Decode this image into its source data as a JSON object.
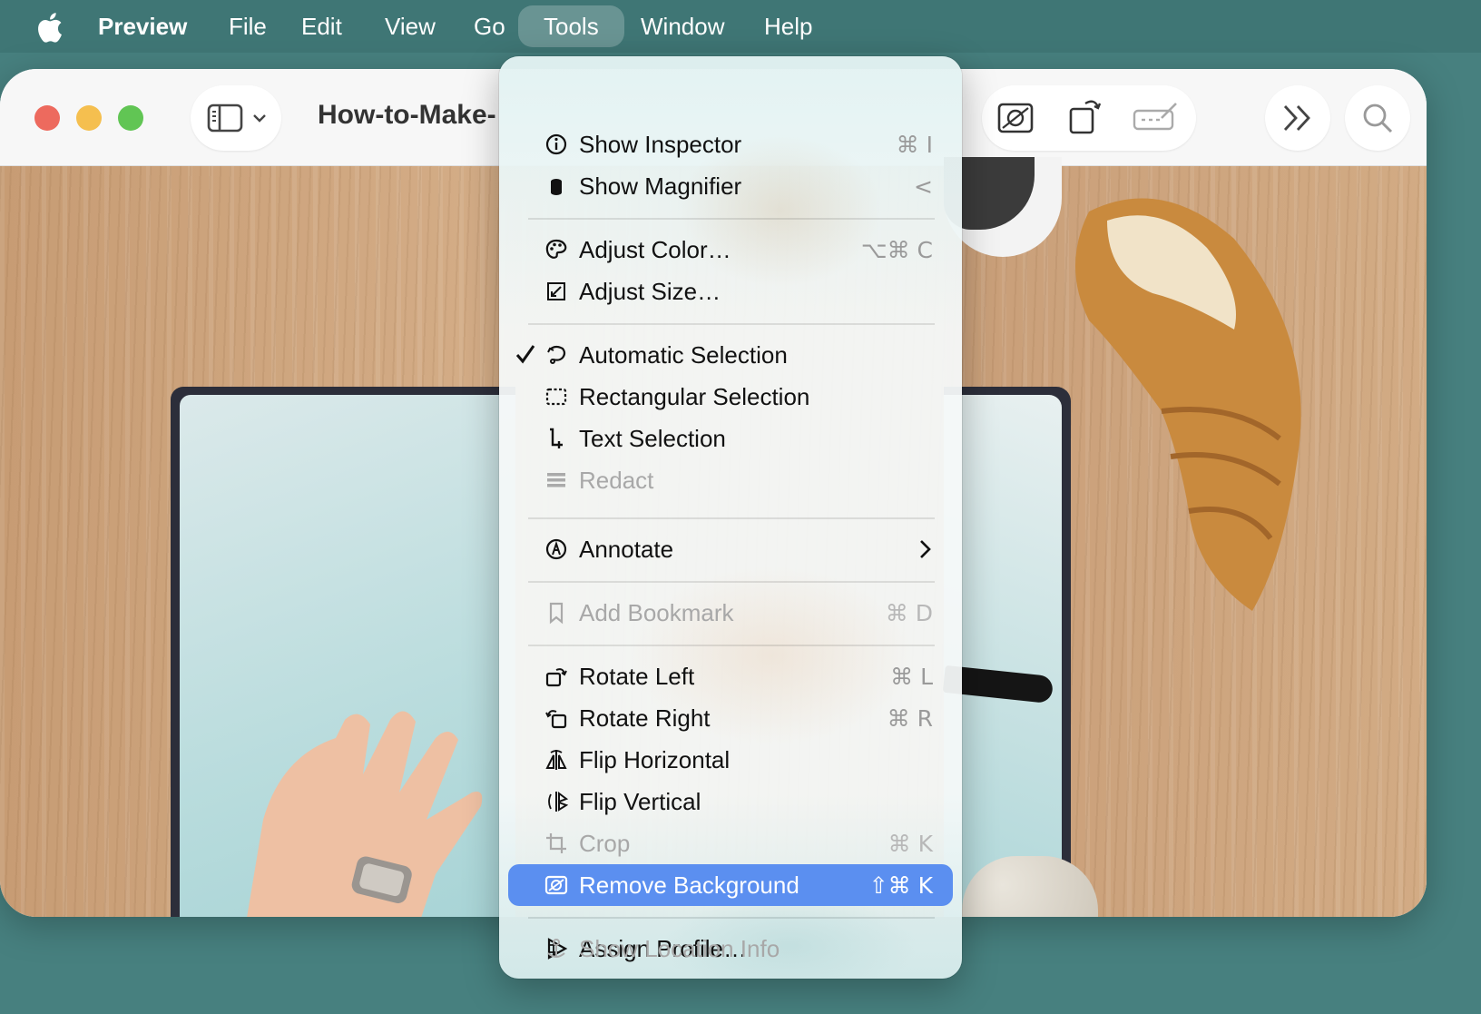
{
  "menubar": {
    "app_name": "Preview",
    "items": [
      "File",
      "Edit",
      "View",
      "Go",
      "Tools",
      "Window",
      "Help"
    ],
    "active_item": "Tools"
  },
  "window": {
    "title": "How-to-Make-"
  },
  "tools_menu": {
    "items": [
      {
        "label": "Show Inspector",
        "shortcut": "⌘ I",
        "icon": "info-icon"
      },
      {
        "label": "Show Magnifier",
        "shortcut": "<",
        "icon": "magnifier-icon"
      },
      {
        "label": "Adjust Color…",
        "shortcut": "⌥⌘ C",
        "icon": "palette-icon"
      },
      {
        "label": "Adjust Size…",
        "shortcut": "",
        "icon": "resize-icon"
      },
      {
        "label": "Automatic Selection",
        "shortcut": "",
        "icon": "lasso-icon",
        "checked": true
      },
      {
        "label": "Rectangular Selection",
        "shortcut": "",
        "icon": "rectangle-selection-icon"
      },
      {
        "label": "Text Selection",
        "shortcut": "",
        "icon": "text-cursor-icon"
      },
      {
        "label": "Redact",
        "shortcut": "",
        "icon": "redact-icon",
        "disabled": true
      },
      {
        "label": "Annotate",
        "shortcut": "",
        "icon": "annotate-icon",
        "submenu": true
      },
      {
        "label": "Add Bookmark",
        "shortcut": "⌘ D",
        "icon": "bookmark-icon",
        "disabled": true
      },
      {
        "label": "Rotate Left",
        "shortcut": "⌘ L",
        "icon": "rotate-left-icon"
      },
      {
        "label": "Rotate Right",
        "shortcut": "⌘ R",
        "icon": "rotate-right-icon"
      },
      {
        "label": "Flip Horizontal",
        "shortcut": "",
        "icon": "flip-horizontal-icon"
      },
      {
        "label": "Flip Vertical",
        "shortcut": "",
        "icon": "flip-vertical-icon"
      },
      {
        "label": "Crop",
        "shortcut": "⌘ K",
        "icon": "crop-icon",
        "disabled": true
      },
      {
        "label": "Remove Background",
        "shortcut": "⇧⌘ K",
        "icon": "remove-background-icon",
        "highlighted": true
      },
      {
        "label": "Assign Profile…",
        "shortcut": "",
        "icon": "profile-icon"
      },
      {
        "label": "Show Location Info",
        "shortcut": "",
        "icon": "location-icon",
        "disabled": true
      }
    ]
  },
  "colors": {
    "desktop": "#47807f",
    "menubar": "#3f7675",
    "highlight": "#5b8ff0",
    "traffic_red": "#ed6a5e",
    "traffic_yellow": "#f5bf4f",
    "traffic_green": "#61c554"
  }
}
